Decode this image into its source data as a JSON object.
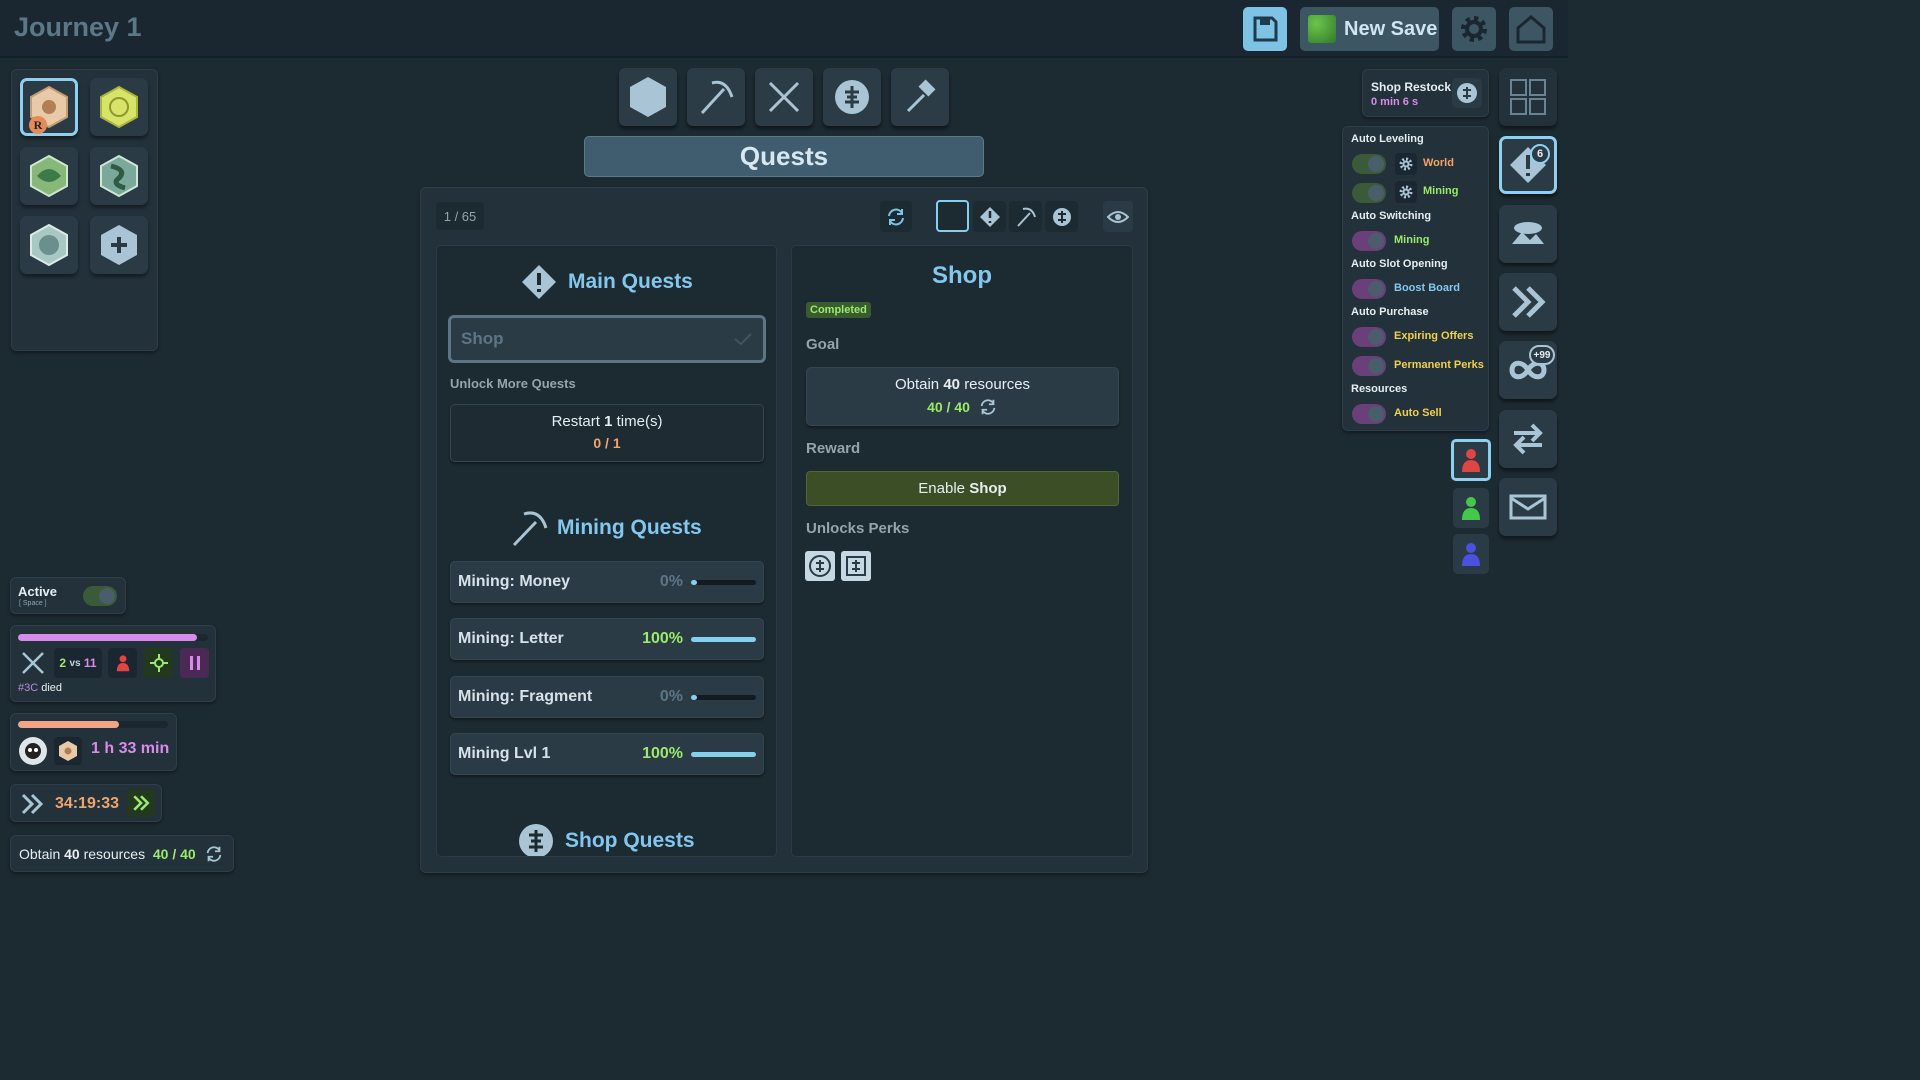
{
  "header": {
    "title": "Journey 1",
    "new_save_label": "New Save"
  },
  "toolbar": {
    "tabs": [
      "hexagon",
      "pickaxe",
      "crossed-swords",
      "shop",
      "hammer"
    ],
    "section_title": "Quests"
  },
  "quest_panel": {
    "counter": "1 / 65",
    "main": {
      "title": "Main Quests",
      "selected_quest": "Shop",
      "unlock_label": "Unlock More Quests",
      "restart_prefix": "Restart",
      "restart_count": "1",
      "restart_suffix": "time(s)",
      "restart_progress": "0 / 1"
    },
    "mining": {
      "title": "Mining Quests",
      "items": [
        {
          "label": "Mining: Money",
          "pct": "0%",
          "fill": 0
        },
        {
          "label": "Mining: Letter",
          "pct": "100%",
          "fill": 1
        },
        {
          "label": "Mining: Fragment",
          "pct": "0%",
          "fill": 0
        },
        {
          "label": "Mining Lvl 1",
          "pct": "100%",
          "fill": 1
        }
      ]
    },
    "shop_section_title": "Shop Quests"
  },
  "detail": {
    "title": "Shop",
    "status": "Completed",
    "goal_label": "Goal",
    "goal_prefix": "Obtain",
    "goal_amount": "40",
    "goal_suffix": "resources",
    "goal_progress": "40 / 40",
    "reward_label": "Reward",
    "reward_prefix": "Enable",
    "reward_bold": "Shop",
    "unlocks_label": "Unlocks Perks"
  },
  "restock": {
    "label": "Shop Restock",
    "time": "0 min 6 s"
  },
  "automation": {
    "auto_leveling": "Auto Leveling",
    "world": "World",
    "mining": "Mining",
    "auto_switching": "Auto Switching",
    "switch_mining": "Mining",
    "auto_slot": "Auto Slot Opening",
    "boost_board": "Boost Board",
    "auto_purchase": "Auto Purchase",
    "expiring_offers": "Expiring Offers",
    "permanent_perks": "Permanent Perks",
    "resources": "Resources",
    "auto_sell": "Auto Sell"
  },
  "badges": {
    "quests": "6",
    "infinity": "+99"
  },
  "status": {
    "active_label": "Active",
    "active_hint": "[ Space ]",
    "battle_left": "2",
    "battle_vs": "vs",
    "battle_right": "11",
    "battle_tag": "#3C",
    "battle_event": "died",
    "timer_remaining": "1 h 33 min",
    "countdown": "34:19:33",
    "goal_prefix": "Obtain",
    "goal_amount": "40",
    "goal_suffix": "resources",
    "goal_progress": "40 / 40"
  },
  "world_slot_badge": "R",
  "colors": {
    "accent": "#84c7ee",
    "completed": "#9bea6a",
    "warning": "#f2a46a",
    "purple": "#d98aeb"
  }
}
